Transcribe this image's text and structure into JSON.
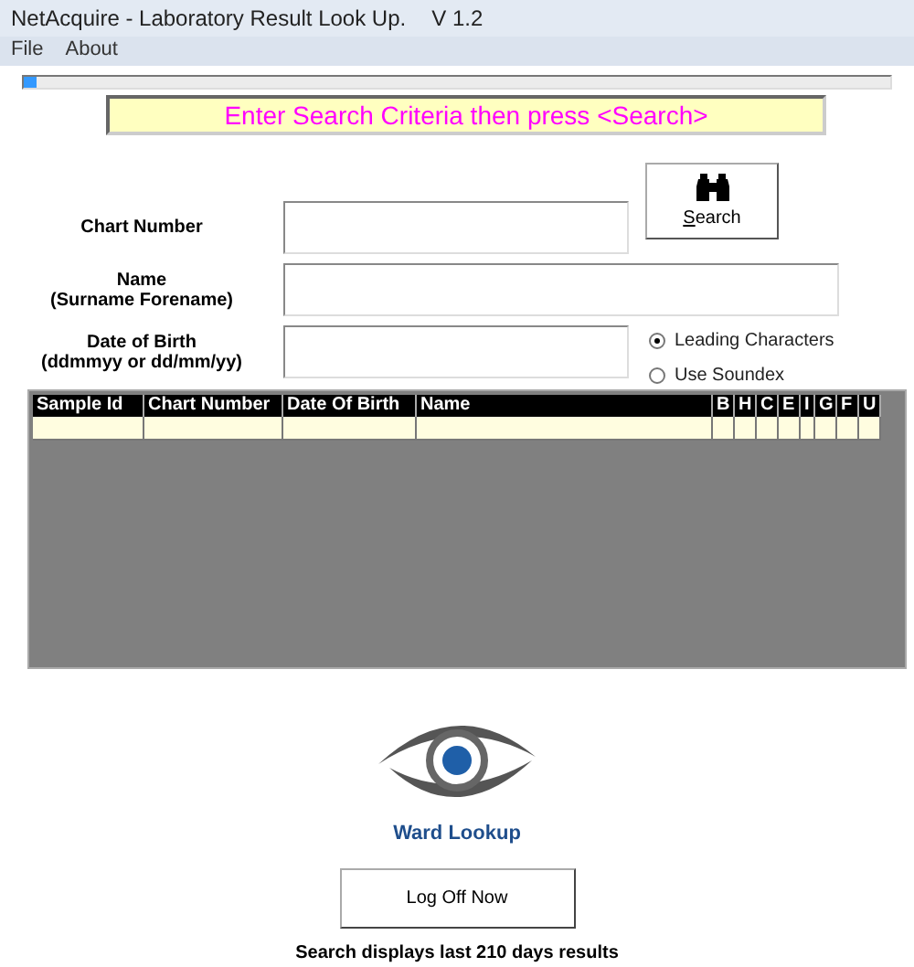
{
  "window": {
    "title": "NetAcquire - Laboratory Result Look Up.",
    "version": "V 1.2"
  },
  "menu": [
    "File",
    "About"
  ],
  "progress": {
    "level": 0.015
  },
  "banner": "Enter Search Criteria then press <Search>",
  "search_button": "Search",
  "fields": [
    {
      "label": "Chart Number",
      "wide": false
    },
    {
      "label": "Name",
      "sublabel": "(Surname Forename)",
      "wide": true
    },
    {
      "label": "Date of Birth",
      "sublabel": "(ddmmyy or dd/mm/yy)",
      "wide": false
    }
  ],
  "match_options": [
    {
      "label": "Leading Characters",
      "selected": true
    },
    {
      "label": "Use Soundex",
      "selected": false
    }
  ],
  "table": {
    "columns": [
      "Sample Id",
      "Chart Number",
      "Date Of Birth",
      "Name",
      "B",
      "H",
      "C",
      "E",
      "I",
      "G",
      "F",
      "U"
    ]
  },
  "logo": {
    "caption": "Ward Lookup"
  },
  "log_off_button": "Log Off Now",
  "footer": "Search displays last 210 days results"
}
